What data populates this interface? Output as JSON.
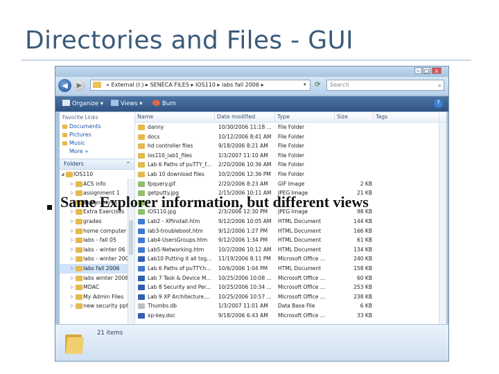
{
  "slide": {
    "title": "Directories and Files - GUI",
    "bullet": "Same Explorer information, but different views"
  },
  "window": {
    "controls": {
      "minimize": "–",
      "maximize": "□",
      "close": "x"
    },
    "address": {
      "path": "« External (I:) ▸ SENECA FILES ▸ IOS110 ▸ labs fall 2006 ▸",
      "dropdown": "▾"
    },
    "search_placeholder": "Search",
    "toolbar": {
      "organize": "Organize ▾",
      "views": "Views ▾",
      "burn": "Burn",
      "help": "?"
    },
    "favorites": {
      "header": "Favorite Links",
      "items": [
        "Documents",
        "Pictures",
        "Music"
      ],
      "more": "More »"
    },
    "folders": {
      "header": "Folders",
      "toggle": "^",
      "tree": [
        {
          "label": "IOS110",
          "arrow": "◢"
        },
        {
          "label": "ACS info",
          "arrow": "▷"
        },
        {
          "label": "assignment 1",
          "arrow": "▷"
        },
        {
          "label": "assignments",
          "arrow": "▷"
        },
        {
          "label": "Extra Exercises",
          "arrow": "▷"
        },
        {
          "label": "grades",
          "arrow": "▷"
        },
        {
          "label": "home computer",
          "arrow": "▷"
        },
        {
          "label": "labs - fall 05",
          "arrow": "▷"
        },
        {
          "label": "labs - winter 06",
          "arrow": "▷"
        },
        {
          "label": "labs - winter 200",
          "arrow": "▷"
        },
        {
          "label": "labs fall 2006",
          "arrow": "▷"
        },
        {
          "label": "labs winter 2008",
          "arrow": "▷"
        },
        {
          "label": "MDAC",
          "arrow": "▷"
        },
        {
          "label": "My Admin Files",
          "arrow": "▷"
        },
        {
          "label": "new security ppt",
          "arrow": "▷"
        }
      ]
    },
    "columns": {
      "name": "Name",
      "date": "Date modified",
      "type": "Type",
      "size": "Size",
      "tags": "Tags"
    },
    "files": [
      {
        "name": "danny",
        "date": "10/30/2006 11:18 ...",
        "type": "File Folder",
        "size": "",
        "icon": "folder"
      },
      {
        "name": "docs",
        "date": "10/12/2006 8:41 AM",
        "type": "File Folder",
        "size": "",
        "icon": "folder"
      },
      {
        "name": "hd controller files",
        "date": "9/18/2006 8:21 AM",
        "type": "File Folder",
        "size": "",
        "icon": "folder"
      },
      {
        "name": "ios110_lab1_files",
        "date": "1/3/2007 11:10 AM",
        "type": "File Folder",
        "size": "",
        "icon": "folder"
      },
      {
        "name": "Lab 6 Paths of puTTY_f...",
        "date": "2/20/2006 10:36 AM",
        "type": "File Folder",
        "size": "",
        "icon": "folder"
      },
      {
        "name": "Lab 10 download files",
        "date": "10/2/2006 12:36 PM",
        "type": "File Folder",
        "size": "",
        "icon": "folder"
      },
      {
        "name": "fpquery.gif",
        "date": "2/20/2006 8:23 AM",
        "type": "GIF Image",
        "size": "2 KB",
        "icon": "image"
      },
      {
        "name": "getputty.jpg",
        "date": "2/15/2006 10:11 AM",
        "type": "JPEG Image",
        "size": "21 KB",
        "icon": "image"
      },
      {
        "name": "",
        "date": "",
        "type": "",
        "size": "",
        "icon": "image"
      },
      {
        "name": "IOS110.jpg",
        "date": "2/3/2006 12:30 PM",
        "type": "JPEG Image",
        "size": "98 KB",
        "icon": "image"
      },
      {
        "name": "Lab2 - XPInstall.htm",
        "date": "9/12/2006 10:05 AM",
        "type": "HTML Document",
        "size": "144 KB",
        "icon": "html"
      },
      {
        "name": "lab3-troubleboot.htm",
        "date": "9/12/2006 1:27 PM",
        "type": "HTML Document",
        "size": "166 KB",
        "icon": "html"
      },
      {
        "name": "Lab4-UsersGroups.htm",
        "date": "9/12/2006 1:34 PM",
        "type": "HTML Document",
        "size": "61 KB",
        "icon": "html"
      },
      {
        "name": "Lab5-Networking.htm",
        "date": "10/2/2006 10:12 AM",
        "type": "HTML Document",
        "size": "134 KB",
        "icon": "html"
      },
      {
        "name": "Lab10 Putting it all tog...",
        "date": "11/19/2006 8:11 PM",
        "type": "Microsoft Office ...",
        "size": "240 KB",
        "icon": "doc"
      },
      {
        "name": "Lab 6 Paths of puTTY.h...",
        "date": "10/6/2006 1:04 PM",
        "type": "HTML Document",
        "size": "158 KB",
        "icon": "html"
      },
      {
        "name": "Lab 7 Task & Device M...",
        "date": "10/25/2006 10:08 ...",
        "type": "Microsoft Office ...",
        "size": "60 KB",
        "icon": "doc"
      },
      {
        "name": "Lab 8 Security and Per...",
        "date": "10/25/2006 10:34 ...",
        "type": "Microsoft Office ...",
        "size": "253 KB",
        "icon": "doc"
      },
      {
        "name": "Lab 9 XP Architecture....",
        "date": "10/25/2006 10:57 ...",
        "type": "Microsoft Office ...",
        "size": "238 KB",
        "icon": "doc"
      },
      {
        "name": "Thumbs.db",
        "date": "1/3/2007 11:01 AM",
        "type": "Data Base File",
        "size": "6 KB",
        "icon": "db"
      },
      {
        "name": "xp-key.doc",
        "date": "9/18/2006 6:43 AM",
        "type": "Microsoft Office ...",
        "size": "33 KB",
        "icon": "doc"
      }
    ],
    "details": {
      "count": "21 items"
    }
  }
}
